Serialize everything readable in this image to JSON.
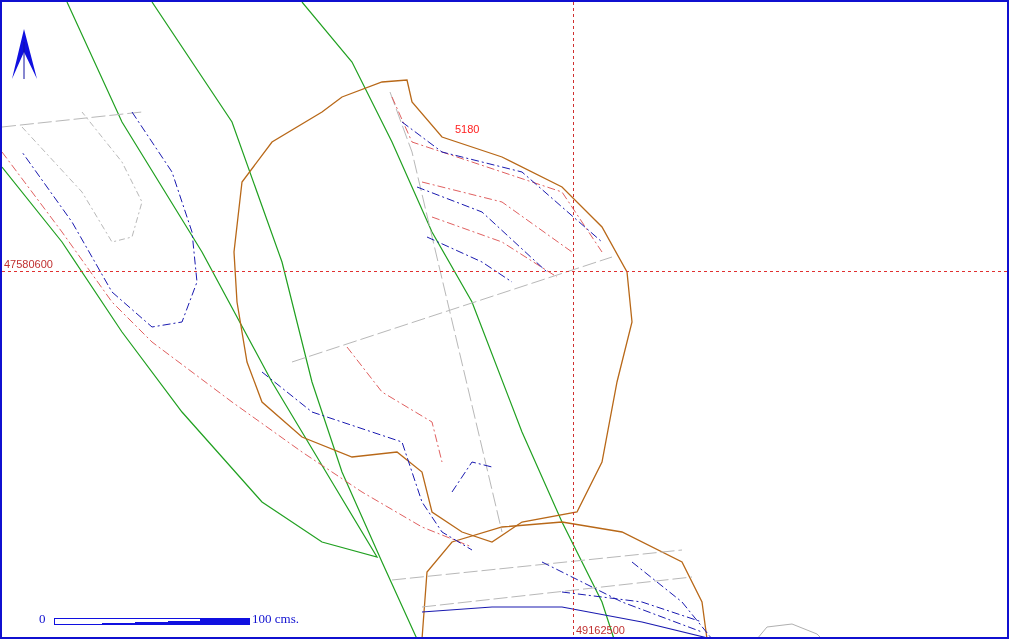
{
  "contour_label": "5180",
  "grid_labels": {
    "northing": "47580600",
    "easting": "49162500"
  },
  "scale_bar": {
    "start": "0",
    "end": "100 cms."
  }
}
